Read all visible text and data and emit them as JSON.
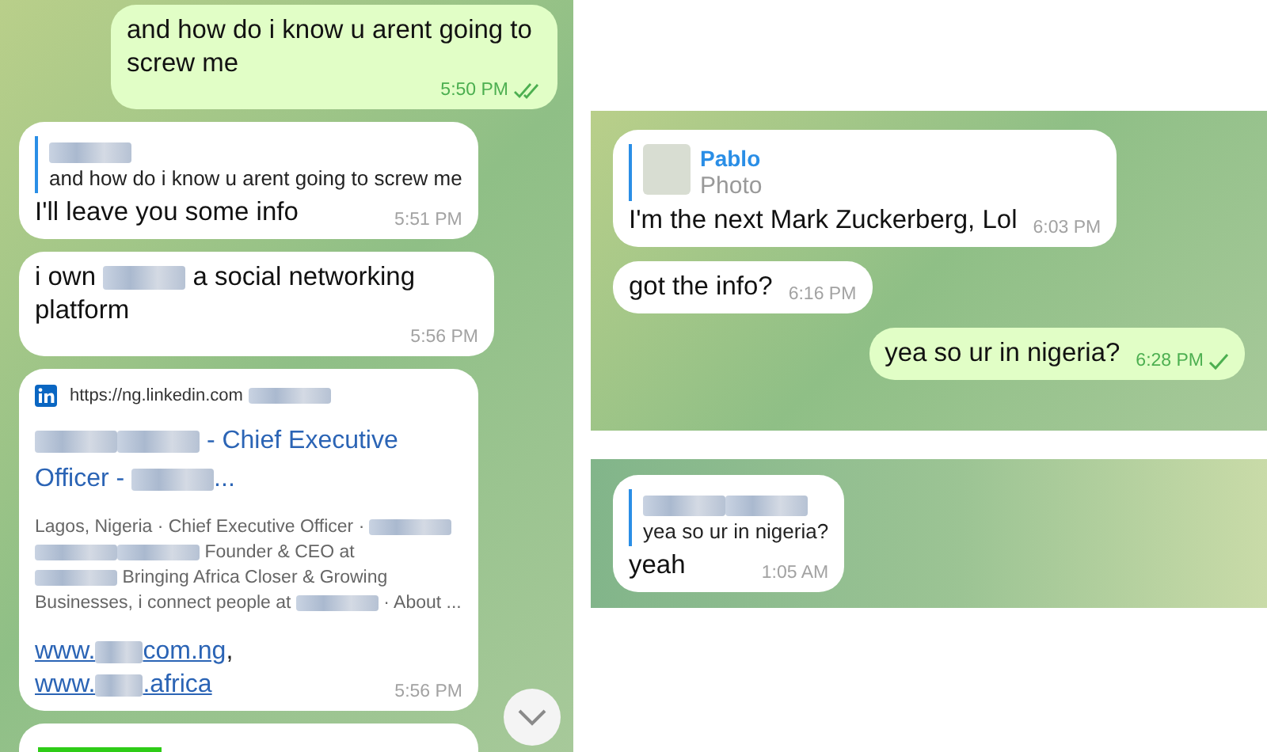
{
  "panels": [
    {
      "messages": [
        {
          "kind": "text",
          "outgoing": true,
          "body": [
            {
              "kind": "text",
              "text": "and how do i know u arent going to screw me"
            }
          ],
          "time": "5:50 PM",
          "read": true
        },
        {
          "kind": "text",
          "outgoing": false,
          "reply": {
            "name": [
              {
                "kind": "blur"
              }
            ],
            "text": "and how do i know u arent going to screw me"
          },
          "body": [
            {
              "kind": "text",
              "text": "I'll leave you some info"
            }
          ],
          "time": "5:51 PM"
        },
        {
          "kind": "text",
          "outgoing": false,
          "body": [
            {
              "kind": "text",
              "text": "i own "
            },
            {
              "kind": "blur"
            },
            {
              "kind": "text",
              "text": " a social networking platform"
            }
          ],
          "time": "5:56 PM"
        },
        {
          "kind": "link_preview",
          "outgoing": false,
          "source": [
            {
              "kind": "text",
              "text": "https://ng.linkedin.com "
            },
            {
              "kind": "blur"
            }
          ],
          "title": [
            {
              "kind": "blur"
            },
            {
              "kind": "blur"
            },
            {
              "kind": "text",
              "text": " - Chief Executive Officer - "
            },
            {
              "kind": "blur"
            },
            {
              "kind": "text",
              "text": "..."
            }
          ],
          "description": [
            [
              {
                "kind": "text",
                "text": "Lagos, Nigeria · Chief Executive Officer · "
              },
              {
                "kind": "blur"
              }
            ],
            [
              {
                "kind": "blur"
              },
              {
                "kind": "blur"
              },
              {
                "kind": "text",
                "text": " Founder & CEO at"
              }
            ],
            [
              {
                "kind": "blur"
              },
              {
                "kind": "text",
                "text": " Bringing Africa Closer & Growing"
              }
            ],
            [
              {
                "kind": "text",
                "text": "Businesses, i connect people at "
              },
              {
                "kind": "blur"
              },
              {
                "kind": "text",
                "text": " · About ..."
              }
            ]
          ],
          "links": [
            [
              {
                "kind": "link",
                "text": "www."
              },
              {
                "kind": "blur"
              },
              {
                "kind": "link",
                "text": "com.ng"
              },
              {
                "kind": "text",
                "text": ","
              }
            ],
            [
              {
                "kind": "link",
                "text": "www."
              },
              {
                "kind": "blur"
              },
              {
                "kind": "link",
                "text": ".africa"
              }
            ]
          ],
          "time": "5:56 PM"
        },
        {
          "kind": "image",
          "outgoing": false
        }
      ]
    },
    {
      "messages": [
        {
          "kind": "text",
          "outgoing": false,
          "reply": {
            "name": [
              {
                "kind": "text",
                "text": "Pablo"
              }
            ],
            "text": "Photo",
            "thumbnail": true
          },
          "body": [
            {
              "kind": "text",
              "text": "I'm the next Mark Zuckerberg, Lol"
            }
          ],
          "time": "6:03 PM"
        },
        {
          "kind": "text",
          "outgoing": false,
          "body": [
            {
              "kind": "text",
              "text": "got the info?"
            }
          ],
          "time": "6:16 PM"
        },
        {
          "kind": "text",
          "outgoing": true,
          "body": [
            {
              "kind": "text",
              "text": "yea so ur in nigeria?"
            }
          ],
          "time": "6:28 PM",
          "read": false
        }
      ]
    },
    {
      "messages": [
        {
          "kind": "text",
          "outgoing": false,
          "reply": {
            "name": [
              {
                "kind": "blur"
              },
              {
                "kind": "blur"
              }
            ],
            "text": "yea so ur in nigeria?"
          },
          "body": [
            {
              "kind": "text",
              "text": "yeah"
            }
          ],
          "time": "1:05 AM"
        }
      ]
    }
  ]
}
